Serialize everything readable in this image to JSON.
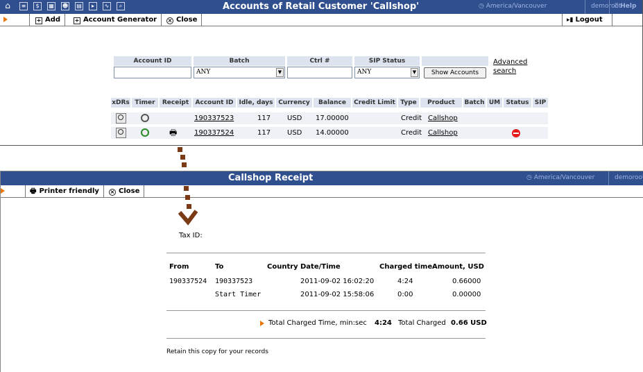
{
  "top_window": {
    "title": "Accounts of Retail Customer 'Callshop'",
    "timezone": "America/Vancouver",
    "user": "demoroot",
    "help": "Help",
    "toolbar": {
      "add": "Add",
      "account_generator": "Account Generator",
      "close": "Close",
      "logout": "Logout"
    },
    "search": {
      "headers": [
        "Account ID",
        "Batch",
        "Ctrl #",
        "SIP Status"
      ],
      "account_id_value": "",
      "batch_value": "ANY",
      "ctrl_value": "",
      "sip_status_value": "ANY",
      "show_button": "Show Accounts",
      "advanced": "Advanced",
      "search": "search"
    },
    "table": {
      "headers": [
        "xDRs",
        "Timer",
        "Receipt",
        "Account ID",
        "Idle, days",
        "Currency",
        "Balance",
        "Credit Limit",
        "Type",
        "Product",
        "Batch",
        "UM",
        "Status",
        "SIP"
      ],
      "rows": [
        {
          "account_id": "190337523",
          "idle": "117",
          "currency": "USD",
          "balance": "17.00000",
          "type": "Credit",
          "product": "Callshop"
        },
        {
          "account_id": "190337524",
          "idle": "117",
          "currency": "USD",
          "balance": "14.00000",
          "type": "Credit",
          "product": "Callshop"
        }
      ]
    }
  },
  "receipt_window": {
    "title": "Callshop Receipt",
    "timezone": "America/Vancouver",
    "user": "demoroot",
    "toolbar": {
      "printer_friendly": "Printer friendly",
      "close": "Close"
    },
    "tax_id_label": "Tax ID:",
    "headers": {
      "from": "From",
      "to": "To",
      "country": "Country",
      "datetime": "Date/Time",
      "charged_time": "Charged time",
      "amount": "Amount, USD"
    },
    "rows": [
      {
        "from": "190337524",
        "to": "190337523",
        "datetime": "2011-09-02 16:02:20",
        "charged": "4:24",
        "amount": "0.66000"
      },
      {
        "from": "",
        "to": "Start Timer",
        "datetime": "2011-09-02 15:58:06",
        "charged": "0:00",
        "amount": "0.00000"
      }
    ],
    "total_time_label": "Total Charged Time, min:sec",
    "total_time_value": "4:24",
    "total_charged_label": "Total Charged",
    "total_charged_value": "0.66 USD",
    "retain_note": "Retain this copy for your records"
  },
  "colors": {
    "titlebar": "#2f4f8f",
    "arrow": "#7a3a16",
    "accent": "#e8760b"
  }
}
